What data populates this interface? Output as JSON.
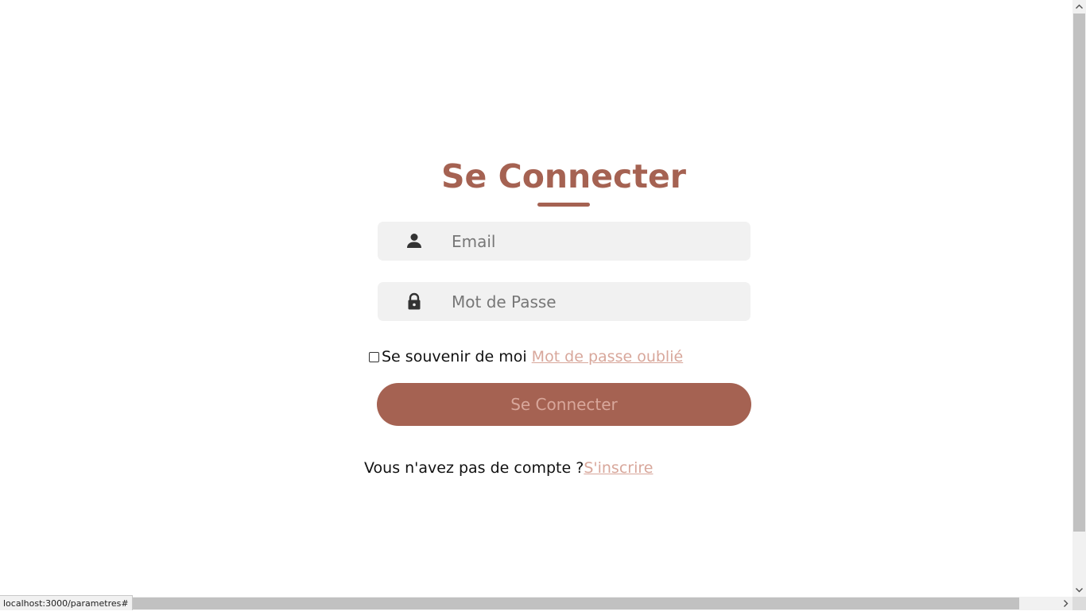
{
  "login": {
    "title": "Se Connecter",
    "email_placeholder": "Email",
    "password_placeholder": "Mot de Passe",
    "remember_label": "Se souvenir de moi",
    "forgot_link": "Mot de passe oublié",
    "submit_label": "Se Connecter",
    "signup_prompt": "Vous n'avez pas de compte ?",
    "signup_link": "S'inscrire"
  },
  "icons": {
    "email": "user-icon",
    "password": "lock-icon"
  },
  "status_bar": {
    "url": "localhost:3000/parametres#"
  },
  "colors": {
    "accent": "#a56252",
    "link": "#d8a79b",
    "field_bg": "#f1f1f1"
  }
}
